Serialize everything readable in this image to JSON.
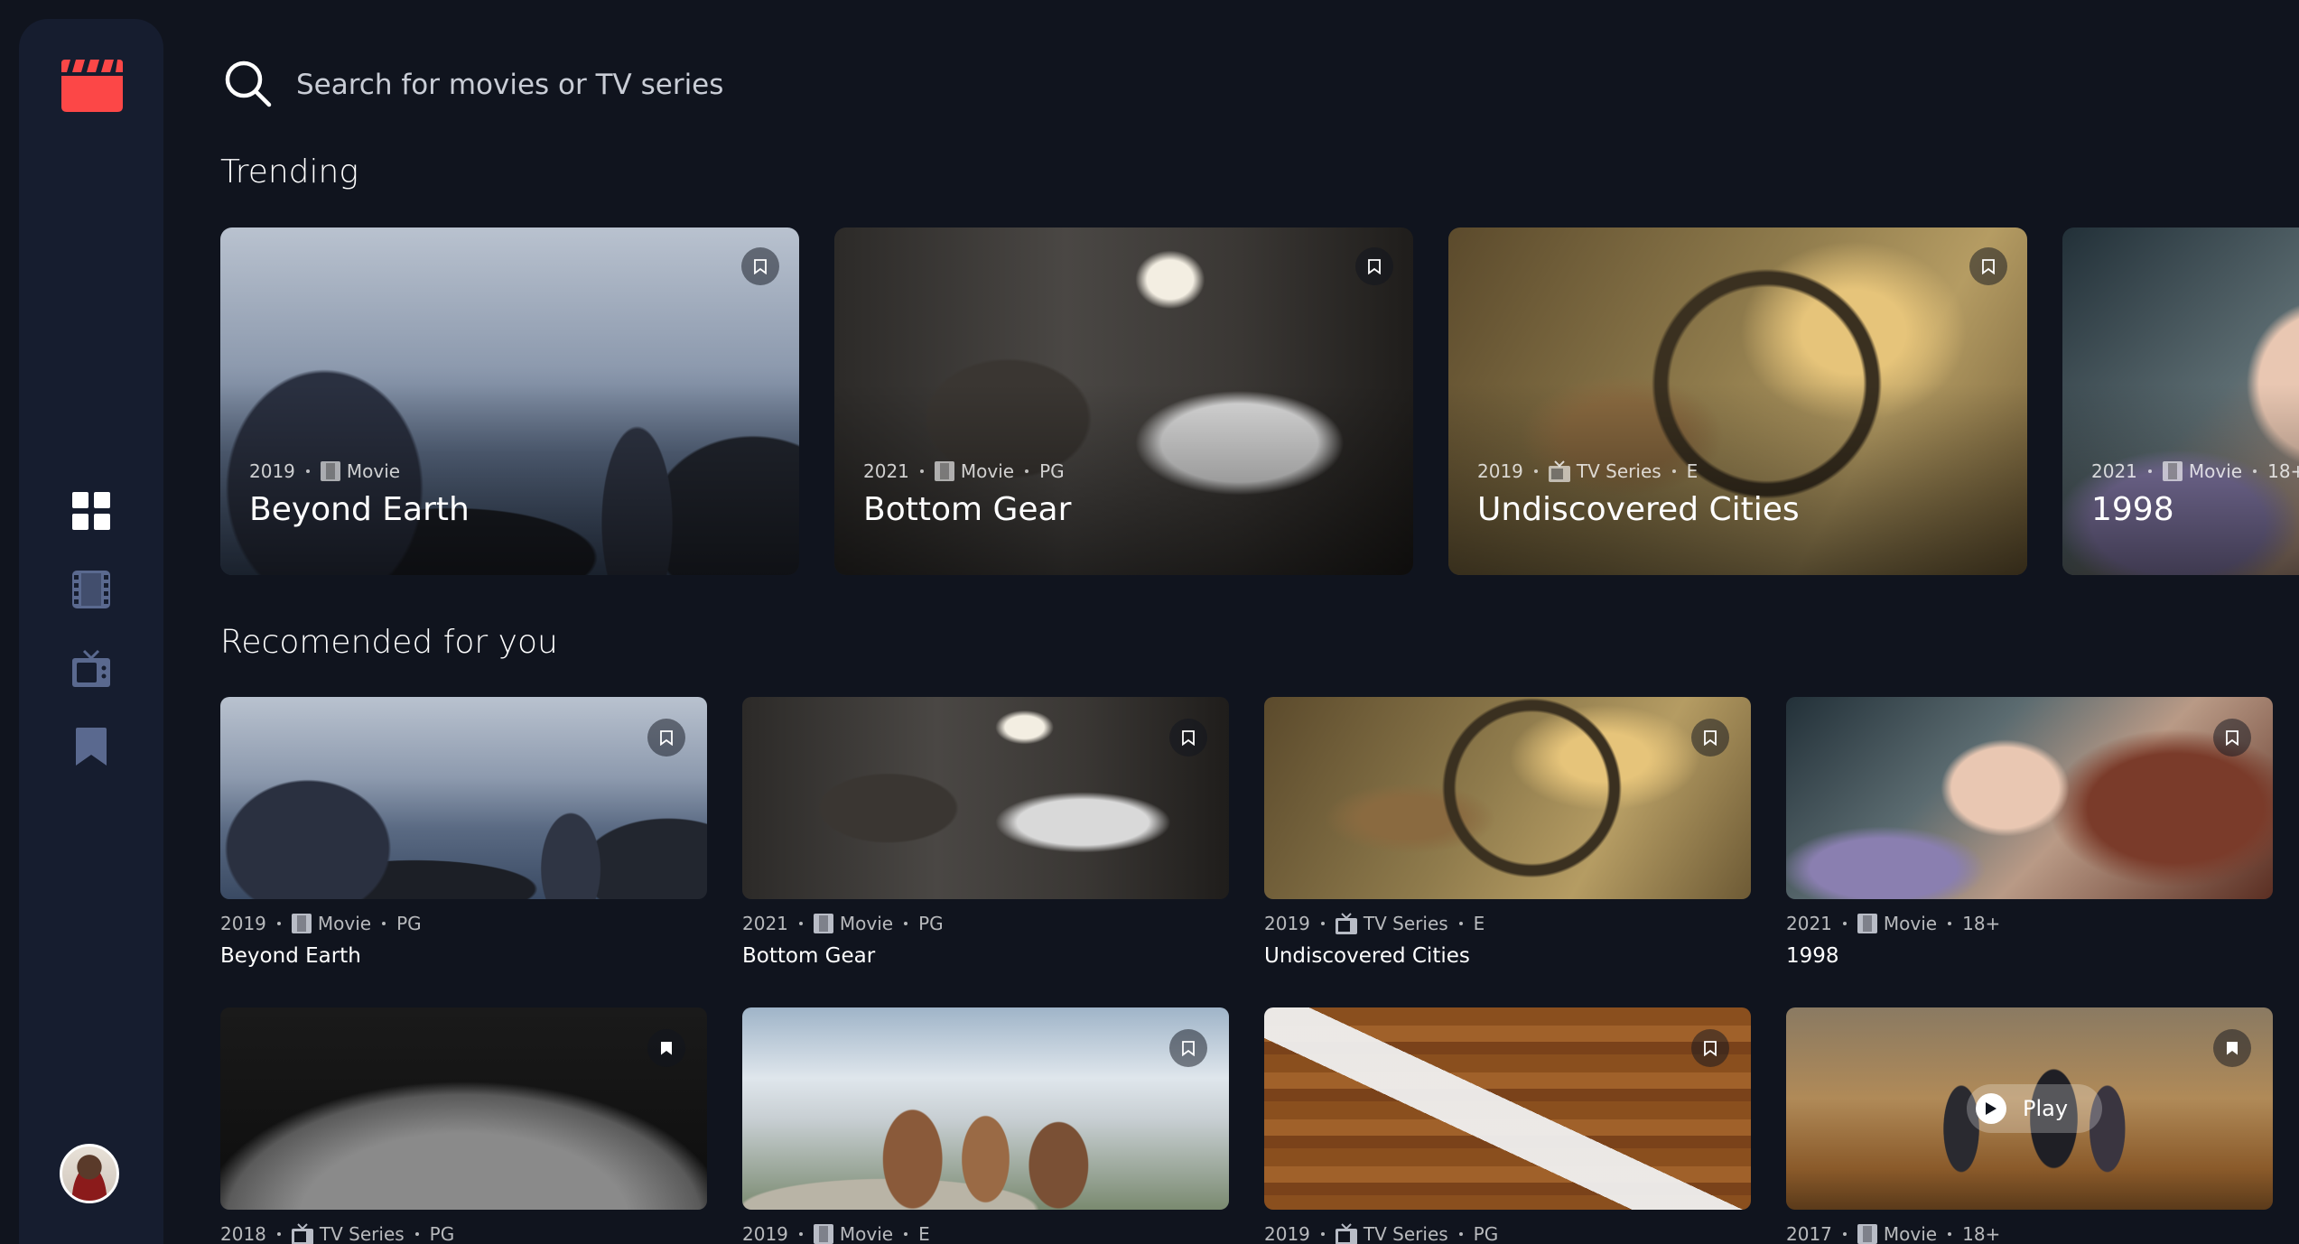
{
  "colors": {
    "background": "#10141e",
    "sidebar": "#161d2f",
    "accent_red": "#fc4747",
    "nav_icon": "#5a698f",
    "nav_icon_active": "#ffffff"
  },
  "sidebar": {
    "logo_icon": "film-clapper-icon",
    "nav": [
      {
        "icon": "grid-icon",
        "label": "Home",
        "active": true
      },
      {
        "icon": "film-icon",
        "label": "Movies",
        "active": false
      },
      {
        "icon": "tv-icon",
        "label": "TV Series",
        "active": false
      },
      {
        "icon": "bookmark-icon",
        "label": "Bookmarked",
        "active": false
      }
    ],
    "avatar_icon": "user-avatar"
  },
  "search": {
    "placeholder": "Search for movies or TV series",
    "value": ""
  },
  "sections": {
    "trending_title": "Trending",
    "recommended_title": "Recomended for you"
  },
  "trending": [
    {
      "year": "2019",
      "category": "Movie",
      "rating": "",
      "title": "Beyond Earth"
    },
    {
      "year": "2021",
      "category": "Movie",
      "rating": "PG",
      "title": "Bottom Gear"
    },
    {
      "year": "2019",
      "category": "TV Series",
      "rating": "E",
      "title": "Undiscovered Cities"
    },
    {
      "year": "2021",
      "category": "Movie",
      "rating": "18+",
      "title": "1998"
    }
  ],
  "recommended": [
    {
      "year": "2019",
      "category": "Movie",
      "rating": "PG",
      "title": "Beyond Earth"
    },
    {
      "year": "2021",
      "category": "Movie",
      "rating": "PG",
      "title": "Bottom Gear"
    },
    {
      "year": "2019",
      "category": "TV Series",
      "rating": "E",
      "title": "Undiscovered Cities"
    },
    {
      "year": "2021",
      "category": "Movie",
      "rating": "18+",
      "title": "1998"
    },
    {
      "year": "2018",
      "category": "TV Series",
      "rating": "PG",
      "title": ""
    },
    {
      "year": "2019",
      "category": "Movie",
      "rating": "E",
      "title": ""
    },
    {
      "year": "2019",
      "category": "TV Series",
      "rating": "PG",
      "title": ""
    },
    {
      "year": "2017",
      "category": "Movie",
      "rating": "18+",
      "title": ""
    }
  ],
  "play_label": "Play"
}
